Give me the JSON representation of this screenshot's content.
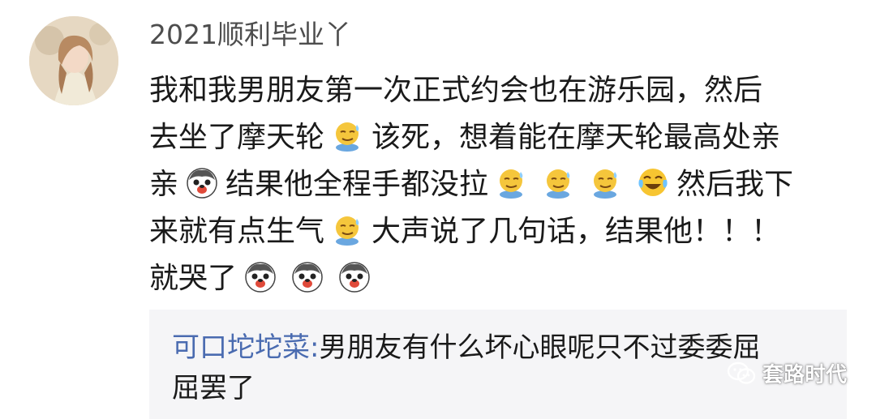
{
  "comment": {
    "username": "2021顺利毕业丫",
    "lines": [
      [
        "我和我男朋友第一次正式约会也在游乐园，然后"
      ],
      [
        "去坐了摩天轮",
        "[emoji:sleepy-sweat-face]",
        "该死，想着能在摩天轮最高处亲"
      ],
      [
        "亲",
        "[emoji:husky-face]",
        "结果他全程手都没拉",
        "[emoji:sleepy-sweat-face]",
        "[emoji:sleepy-sweat-face]",
        "[emoji:sleepy-sweat-face]",
        "[emoji:laugh-cry-face]",
        "然后我下"
      ],
      [
        "来就有点生气",
        "[emoji:sleepy-sweat-face]",
        "大声说了几句话，结果他！！！"
      ],
      [
        "就哭了",
        "[emoji:husky-face]",
        "[emoji:husky-face]",
        "[emoji:husky-face]"
      ]
    ],
    "text": {
      "l1": "我和我男朋友第一次正式约会也在游乐园，然后",
      "l2a": "去坐了摩天轮",
      "l2b": "该死，想着能在摩天轮最高处亲",
      "l3a": "亲",
      "l3b": "结果他全程手都没拉",
      "l3c": "然后我下",
      "l4a": "来就有点生气",
      "l4b": "大声说了几句话，结果他！！！",
      "l5a": "就哭了"
    }
  },
  "reply": {
    "author": "可口坨坨菜:",
    "text_line1": "男朋友有什么坏心眼呢只不过委委屈",
    "text_line2": "屈罢了"
  },
  "watermark": {
    "icon": "wechat-icon",
    "text": "套路时代"
  },
  "colors": {
    "username": "#4d4d4d",
    "reply_author": "#4a6bb0",
    "reply_background": "#f5f5f7"
  }
}
